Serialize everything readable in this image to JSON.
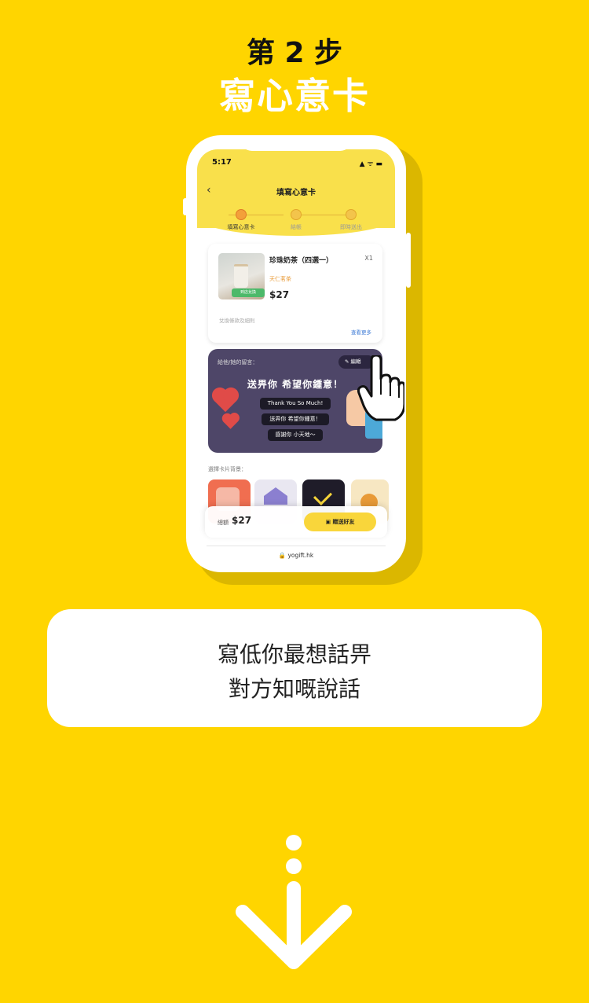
{
  "page": {
    "step_number": "第 2 步",
    "step_title": "寫心意卡"
  },
  "phone": {
    "status": {
      "time": "5:17",
      "icons": "▲ ᯤ ▬"
    },
    "header": {
      "back": "‹",
      "title": "填寫心意卡"
    },
    "stepper": [
      {
        "label": "填寫心意卡",
        "active": true
      },
      {
        "label": "結帳",
        "active": false
      },
      {
        "label": "即時送出",
        "active": false
      }
    ],
    "product": {
      "name": "珍珠奶茶（四選一）",
      "qty": "X1",
      "brand": "天仁茗茶",
      "price": "$27",
      "badge": "到店兌換",
      "terms": "兌換條款及細則",
      "view_more": "查看更多"
    },
    "message": {
      "label": "給他/她的留言：",
      "edit": "編輯",
      "main": "送畀你 希望你鍾意！",
      "chips": [
        "Thank You So Much!",
        "送畀你 希望你鍾意！",
        "感謝你 小天地～"
      ]
    },
    "backgrounds": {
      "label": "選擇卡片背景："
    },
    "footer": {
      "total_label": "總額",
      "total_price": "$27",
      "gift_button": "贈送好友"
    },
    "url": "🔒 yogift.hk"
  },
  "caption": {
    "line1": "寫低你最想話畀",
    "line2": "對方知嘅說話"
  },
  "colors": {
    "background": "#FFD500",
    "header": "#F9E04B",
    "message_card": "#4E4668",
    "accent": "#F3A03A"
  }
}
